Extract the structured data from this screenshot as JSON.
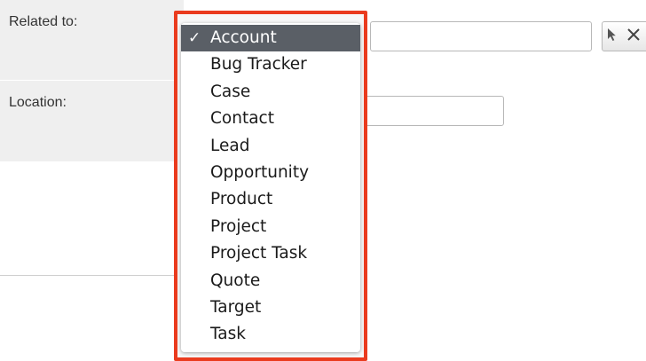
{
  "form": {
    "related_label": "Related to:",
    "location_label": "Location:",
    "related_value": "",
    "location_value": ""
  },
  "dropdown": {
    "selected": "Account",
    "checkmark": "✓",
    "options": [
      "Account",
      "Bug Tracker",
      "Case",
      "Contact",
      "Lead",
      "Opportunity",
      "Product",
      "Project",
      "Project Task",
      "Quote",
      "Target",
      "Task"
    ],
    "highlight_color": "#ea3b1e"
  },
  "icons": {
    "select": "cursor-arrow-icon",
    "clear": "close-x-icon"
  }
}
